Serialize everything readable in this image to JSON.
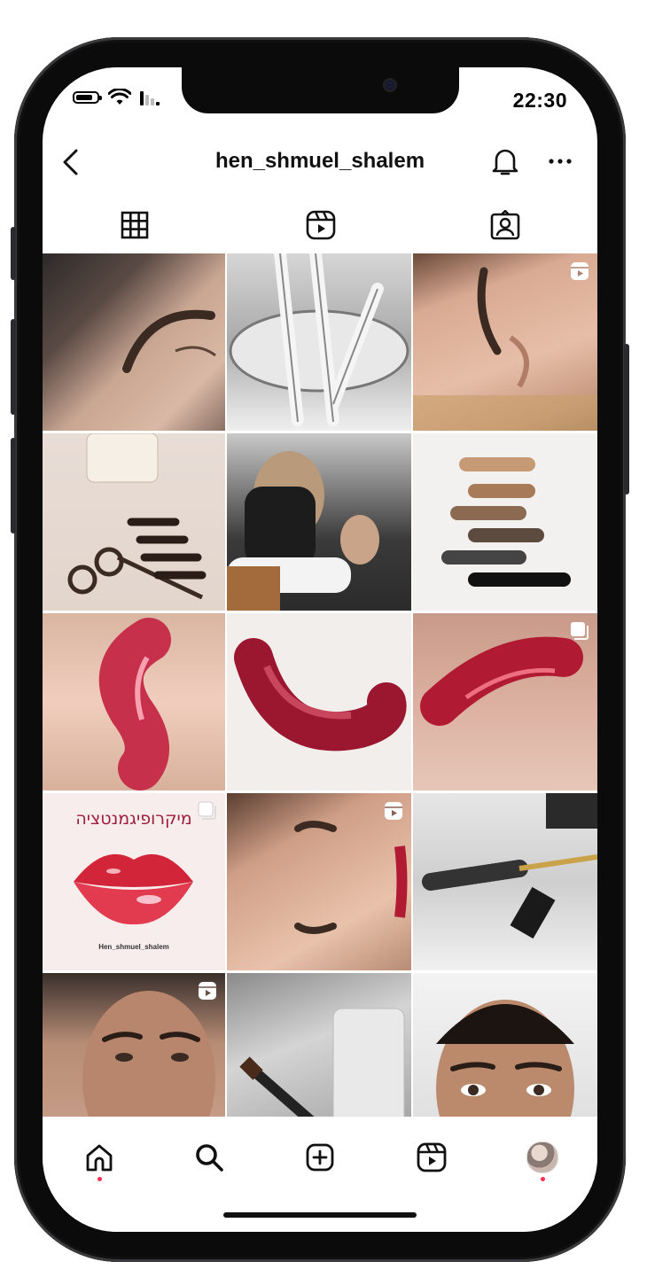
{
  "status_bar": {
    "time": "22:30"
  },
  "header": {
    "username": "hen_shmuel_shalem"
  },
  "tabs": [
    {
      "icon": "grid-icon"
    },
    {
      "icon": "reels-icon"
    },
    {
      "icon": "tagged-icon"
    }
  ],
  "grid": {
    "post_10": {
      "title": "מיקרופיגמנטציה",
      "handle": "Hen_shmuel_shalem"
    }
  },
  "bottom_nav": [
    {
      "icon": "home-icon"
    },
    {
      "icon": "search-icon"
    },
    {
      "icon": "create-icon"
    },
    {
      "icon": "reels-icon"
    },
    {
      "icon": "profile-avatar"
    }
  ],
  "colors": {
    "accent_dot": "#ff2e52",
    "text": "#111111"
  }
}
